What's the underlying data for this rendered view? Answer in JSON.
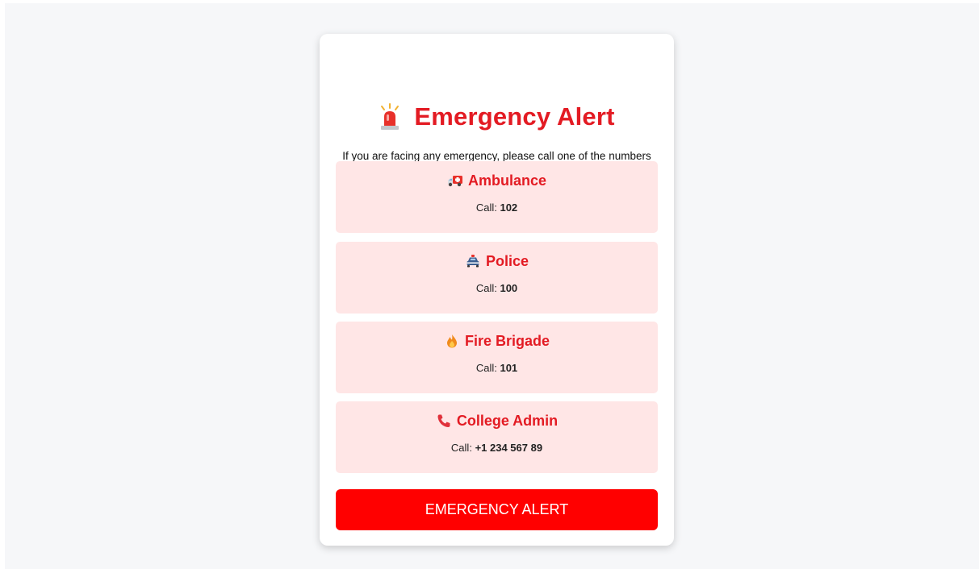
{
  "header": {
    "title": "Emergency Alert",
    "title_icon": "siren-icon",
    "intro": "If you are facing any emergency, please call one of the numbers below or press the Emergency Button."
  },
  "contacts": [
    {
      "icon": "ambulance-icon",
      "name": "Ambulance",
      "call_label": "Call:",
      "number": "102"
    },
    {
      "icon": "police-car-icon",
      "name": "Police",
      "call_label": "Call:",
      "number": "100"
    },
    {
      "icon": "fire-icon",
      "name": "Fire Brigade",
      "call_label": "Call:",
      "number": "101"
    },
    {
      "icon": "phone-icon",
      "name": "College Admin",
      "call_label": "Call:",
      "number": "+1 234 567 89"
    }
  ],
  "emergency_button": {
    "label": "EMERGENCY ALERT"
  },
  "colors": {
    "accent": "#e31b23",
    "button": "#ff0000",
    "card_background": "#ffe6e6",
    "page_background": "#f6f7f9"
  }
}
